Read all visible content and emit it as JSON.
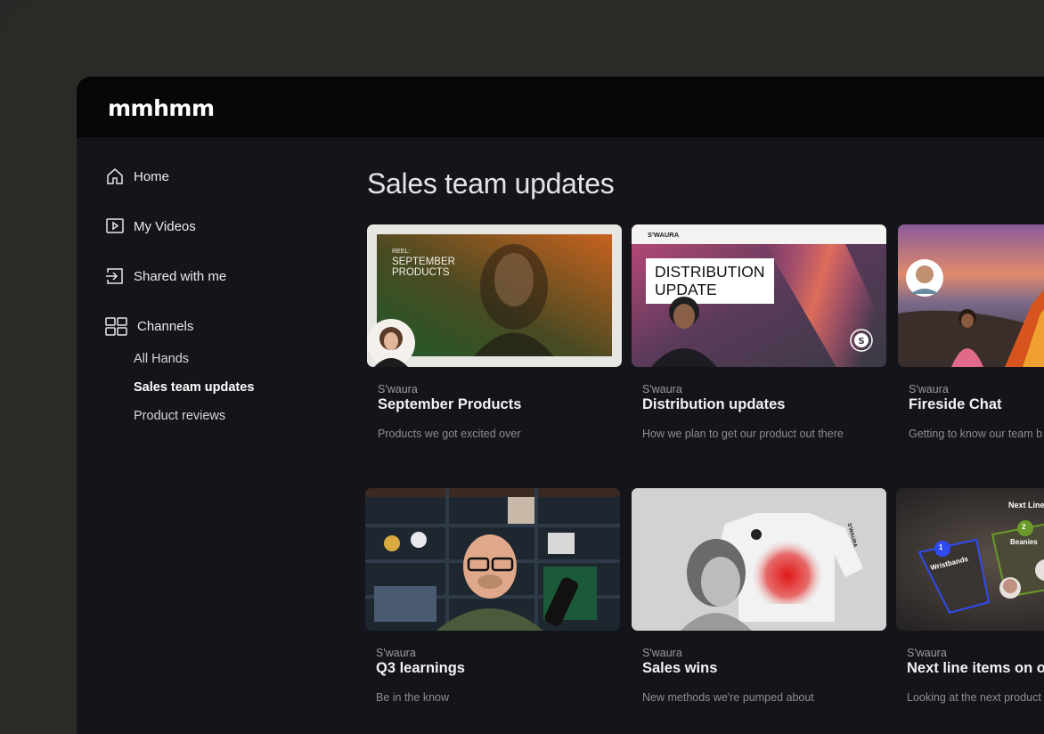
{
  "app": {
    "logo": "mmhmm"
  },
  "nav": {
    "home": "Home",
    "my_videos": "My Videos",
    "shared": "Shared with me",
    "channels": "Channels",
    "sub": [
      "All Hands",
      "Sales team updates",
      "Product reviews"
    ]
  },
  "page": {
    "title": "Sales team updates"
  },
  "cards": [
    {
      "author": "S'waura",
      "title": "September Products",
      "desc": "Products we got excited over",
      "thumb_lines": [
        "REEL:",
        "SEPTEMBER",
        "PRODUCTS"
      ]
    },
    {
      "author": "S'waura",
      "title": "Distribution updates",
      "desc": "How we plan to get our product out there",
      "thumb_brand": "S'WAURA",
      "thumb_lines": [
        "DISTRIBUTION",
        "UPDATE"
      ]
    },
    {
      "author": "S'waura",
      "title": "Fireside Chat",
      "desc": "Getting to know our team b"
    },
    {
      "author": "S'waura",
      "title": "Q3 learnings",
      "desc": "Be in the know"
    },
    {
      "author": "S'waura",
      "title": "Sales wins",
      "desc": "New methods we're pumped about",
      "thumb_brand": "S'WAURA"
    },
    {
      "author": "S'waura",
      "title": "Next line items on o",
      "desc": "Looking at the next product",
      "thumb_lines": [
        "Next Line",
        "Wristbands",
        "Beanies"
      ],
      "thumb_nums": [
        "1",
        "2"
      ]
    }
  ],
  "colors": {
    "accent_blue": "#2f4bf0",
    "accent_green": "#6a9a2a"
  }
}
